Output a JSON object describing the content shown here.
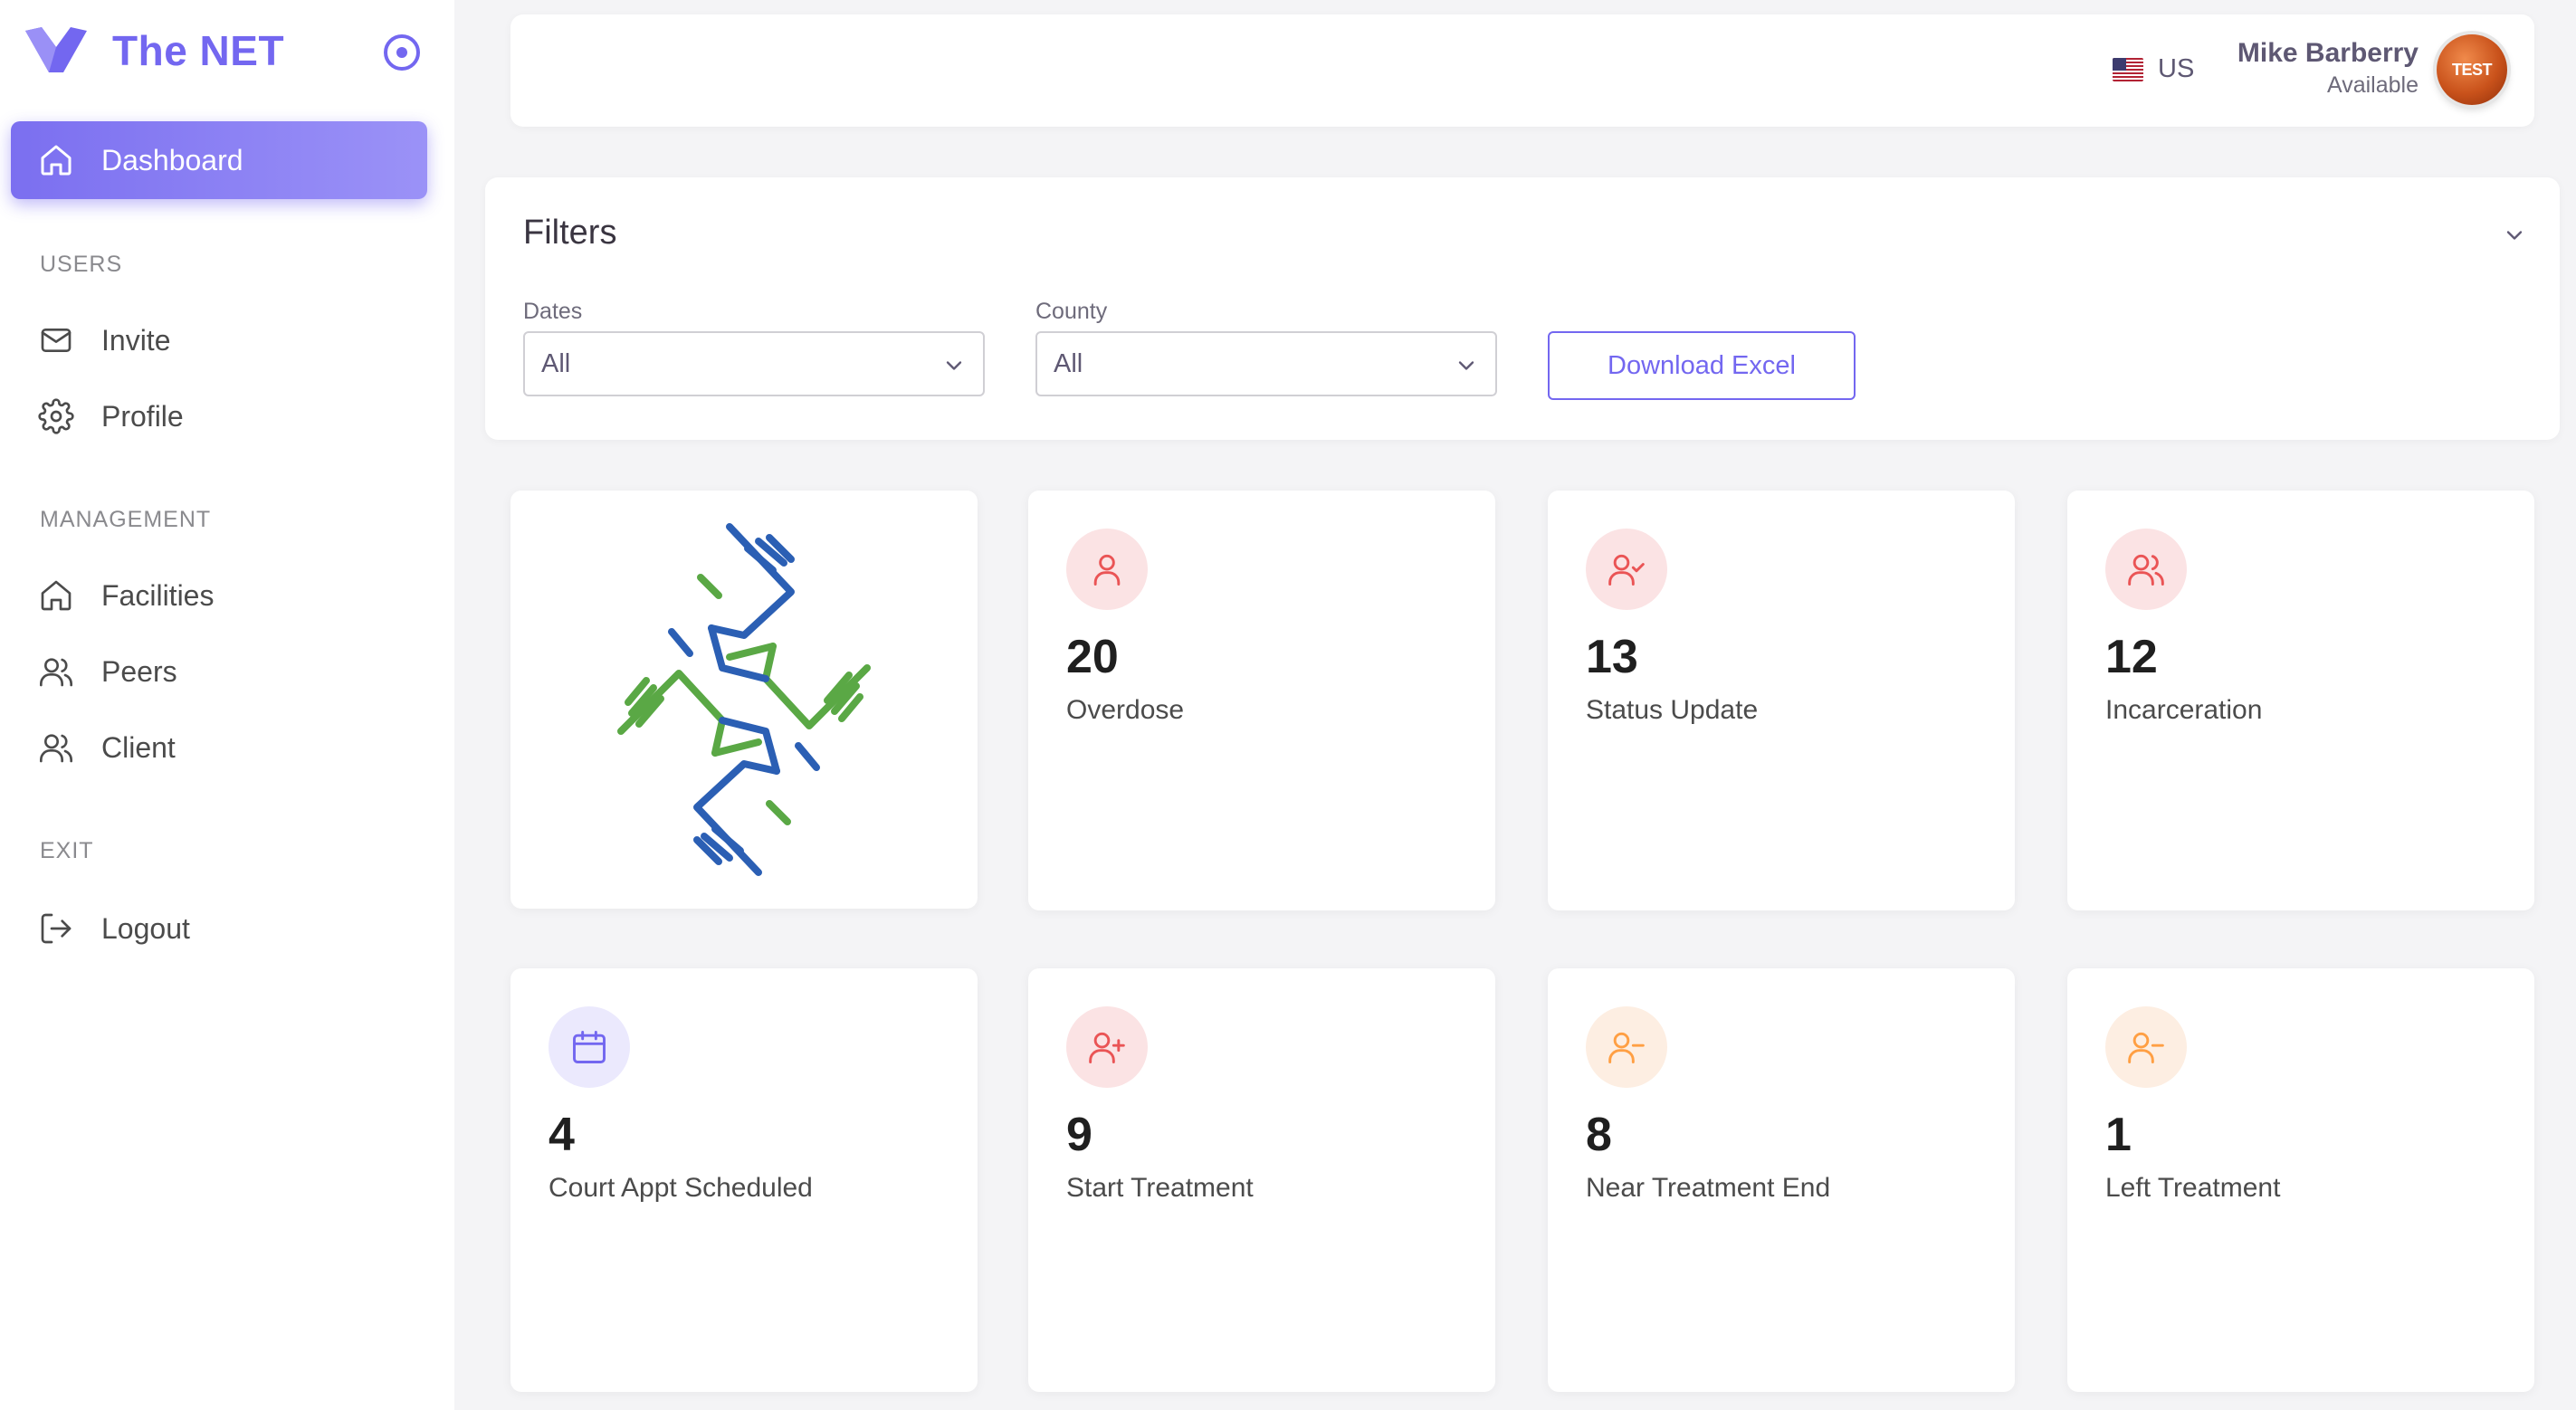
{
  "app": {
    "name": "The NET"
  },
  "sidebar": {
    "active": {
      "label": "Dashboard",
      "icon": "home-icon"
    },
    "sections": [
      {
        "title": "USERS",
        "items": [
          {
            "label": "Invite",
            "icon": "mail-icon"
          },
          {
            "label": "Profile",
            "icon": "gear-icon"
          }
        ]
      },
      {
        "title": "MANAGEMENT",
        "items": [
          {
            "label": "Facilities",
            "icon": "home-icon"
          },
          {
            "label": "Peers",
            "icon": "users-icon"
          },
          {
            "label": "Client",
            "icon": "users-icon"
          }
        ]
      },
      {
        "title": "EXIT",
        "items": [
          {
            "label": "Logout",
            "icon": "logout-icon"
          }
        ]
      }
    ]
  },
  "topbar": {
    "language": "US",
    "user": {
      "name": "Mike Barberry",
      "status": "Available",
      "avatar_text": "TEST"
    }
  },
  "filters": {
    "title": "Filters",
    "dates": {
      "label": "Dates",
      "value": "All"
    },
    "county": {
      "label": "County",
      "value": "All"
    },
    "download_label": "Download Excel"
  },
  "stats": [
    {
      "value": "20",
      "label": "Overdose",
      "icon": "user-icon",
      "color": "#ea5455"
    },
    {
      "value": "13",
      "label": "Status Update",
      "icon": "user-check-icon",
      "color": "#ea5455"
    },
    {
      "value": "12",
      "label": "Incarceration",
      "icon": "users-icon",
      "color": "#ea5455"
    },
    {
      "value": "4",
      "label": "Court Appt Scheduled",
      "icon": "calendar-icon",
      "color": "#7367f0"
    },
    {
      "value": "9",
      "label": "Start Treatment",
      "icon": "user-plus-icon",
      "color": "#ea5455"
    },
    {
      "value": "8",
      "label": "Near Treatment End",
      "icon": "user-minus-icon",
      "color": "#ff9f43"
    },
    {
      "value": "1",
      "label": "Left Treatment",
      "icon": "user-minus-icon",
      "color": "#ff9f43"
    }
  ],
  "colors": {
    "primary": "#7367f0",
    "danger": "#ea5455",
    "warning": "#ff9f43",
    "logo_blue": "#2b5fb4",
    "logo_green": "#5aa845"
  }
}
